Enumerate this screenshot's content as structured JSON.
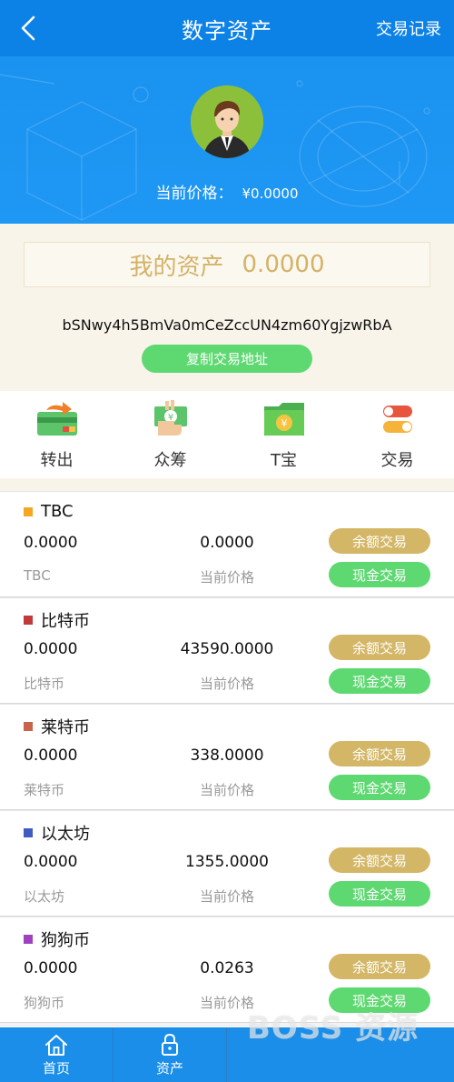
{
  "header": {
    "title": "数字资产",
    "records_link": "交易记录"
  },
  "hero": {
    "price_label": "当前价格：",
    "price_value": "¥0.0000"
  },
  "assets": {
    "label": "我的资产",
    "value": "0.0000",
    "address": "bSNwy4h5BmVa0mCeZccUN4zm60YgjzwRbA",
    "copy_button": "复制交易地址"
  },
  "actions": [
    {
      "label": "转出",
      "icon": "transfer-card-icon"
    },
    {
      "label": "众筹",
      "icon": "crowdfund-hand-icon"
    },
    {
      "label": "T宝",
      "icon": "yuan-folder-icon"
    },
    {
      "label": "交易",
      "icon": "toggle-switch-icon"
    }
  ],
  "coins": [
    {
      "name": "TBC",
      "color": "#f5a623",
      "balance": "0.0000",
      "price": "0.0000",
      "sub": "TBC",
      "price_label": "当前价格",
      "balance_trade": "余额交易",
      "cash_trade": "现金交易"
    },
    {
      "name": "比特币",
      "color": "#c0393b",
      "balance": "0.0000",
      "price": "43590.0000",
      "sub": "比特币",
      "price_label": "当前价格",
      "balance_trade": "余额交易",
      "cash_trade": "现金交易"
    },
    {
      "name": "莱特币",
      "color": "#c8624a",
      "balance": "0.0000",
      "price": "338.0000",
      "sub": "莱特币",
      "price_label": "当前价格",
      "balance_trade": "余额交易",
      "cash_trade": "现金交易"
    },
    {
      "name": "以太坊",
      "color": "#3f5cc2",
      "balance": "0.0000",
      "price": "1355.0000",
      "sub": "以太坊",
      "price_label": "当前价格",
      "balance_trade": "余额交易",
      "cash_trade": "现金交易"
    },
    {
      "name": "狗狗币",
      "color": "#a042c0",
      "balance": "0.0000",
      "price": "0.0263",
      "sub": "狗狗币",
      "price_label": "当前价格",
      "balance_trade": "余额交易",
      "cash_trade": "现金交易"
    }
  ],
  "tabbar": [
    {
      "label": "首页",
      "icon": "home-icon"
    },
    {
      "label": "资产",
      "icon": "lock-icon"
    }
  ],
  "watermark": "BOSS 资源",
  "colors": {
    "primary": "#0d82e6",
    "gold": "#d3b666",
    "green": "#5ed871",
    "cream": "#f8f4ea"
  }
}
